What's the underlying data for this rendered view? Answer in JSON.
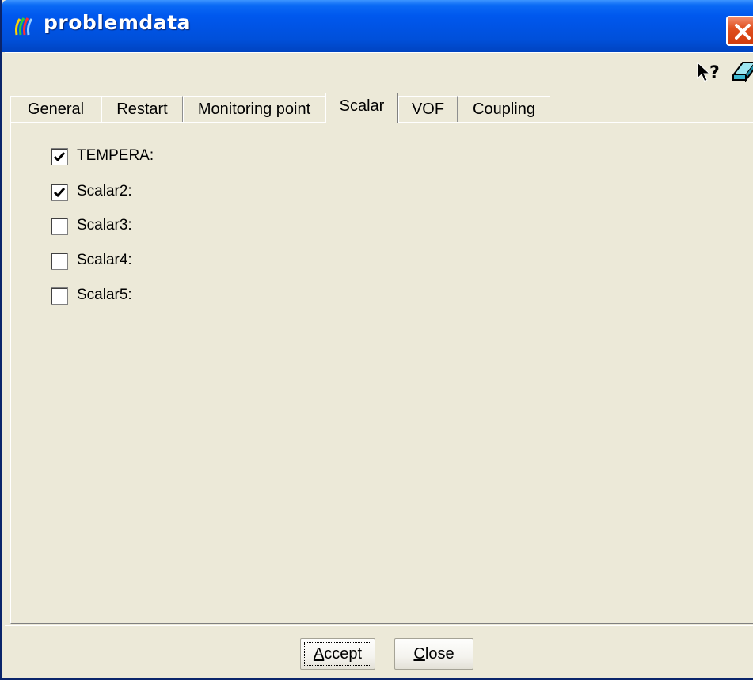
{
  "window": {
    "title": "problemdata"
  },
  "tabs": [
    {
      "label": "General",
      "active": false
    },
    {
      "label": "Restart",
      "active": false
    },
    {
      "label": "Monitoring point",
      "active": false
    },
    {
      "label": "Scalar",
      "active": true
    },
    {
      "label": "VOF",
      "active": false
    },
    {
      "label": "Coupling",
      "active": false
    }
  ],
  "scalars": [
    {
      "label": "TEMPERA:",
      "checked": true
    },
    {
      "label": "Scalar2:",
      "checked": true
    },
    {
      "label": "Scalar3:",
      "checked": false
    },
    {
      "label": "Scalar4:",
      "checked": false
    },
    {
      "label": "Scalar5:",
      "checked": false
    }
  ],
  "buttons": {
    "accept": {
      "mnemonic": "A",
      "rest": "ccept"
    },
    "close": {
      "mnemonic": "C",
      "rest": "lose"
    }
  },
  "icons": {
    "title": "app-icon",
    "close": "close-icon",
    "help": "context-help-icon",
    "erase": "eraser-icon"
  },
  "colors": {
    "titlebar": "#0053E3",
    "face": "#ECE9D8",
    "close": "#D23B0C"
  }
}
